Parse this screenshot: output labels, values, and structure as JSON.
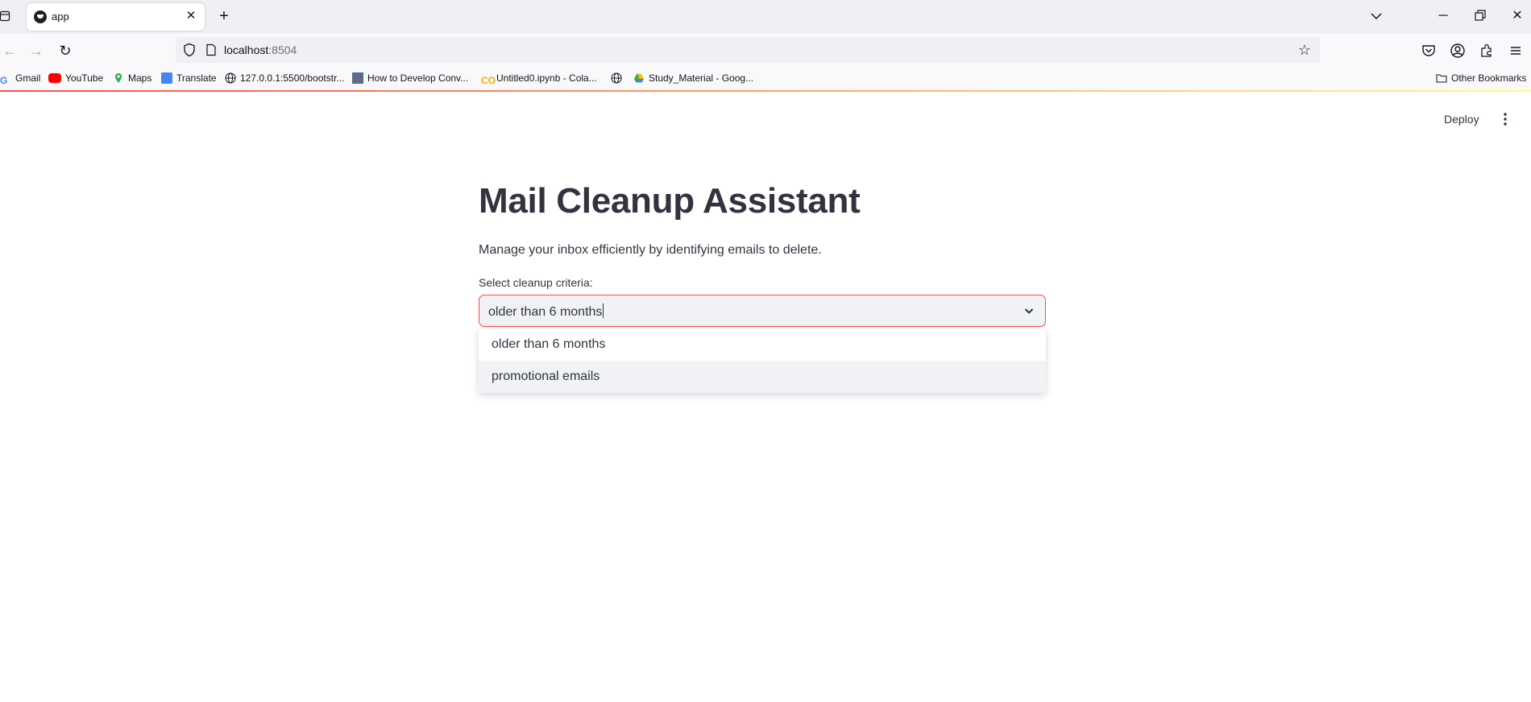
{
  "browser": {
    "tab_title": "app",
    "url_host": "localhost",
    "url_port": ":8504",
    "bookmarks": [
      {
        "label": "Gmail",
        "icon": "google-icon"
      },
      {
        "label": "YouTube",
        "icon": "youtube-icon"
      },
      {
        "label": "Maps",
        "icon": "maps-icon"
      },
      {
        "label": "Translate",
        "icon": "translate-icon"
      },
      {
        "label": "127.0.0.1:5500/bootstr...",
        "icon": "globe-icon"
      },
      {
        "label": "How to Develop Conv...",
        "icon": "site-thumbnail-icon"
      },
      {
        "label": "Untitled0.ipynb - Cola...",
        "icon": "colab-icon"
      },
      {
        "label": "",
        "icon": "globe-icon"
      },
      {
        "label": "Study_Material - Goog...",
        "icon": "google-drive-icon"
      }
    ],
    "other_bookmarks": "Other Bookmarks"
  },
  "app": {
    "deploy_label": "Deploy",
    "title": "Mail Cleanup Assistant",
    "subtitle": "Manage your inbox efficiently by identifying emails to delete.",
    "select_label": "Select cleanup criteria:",
    "select_value": "older than 6 months",
    "options": [
      "older than 6 months",
      "promotional emails"
    ]
  },
  "colors": {
    "accent": "#ff4b4b",
    "text": "#31333f",
    "input_bg": "#f0f2f6"
  }
}
